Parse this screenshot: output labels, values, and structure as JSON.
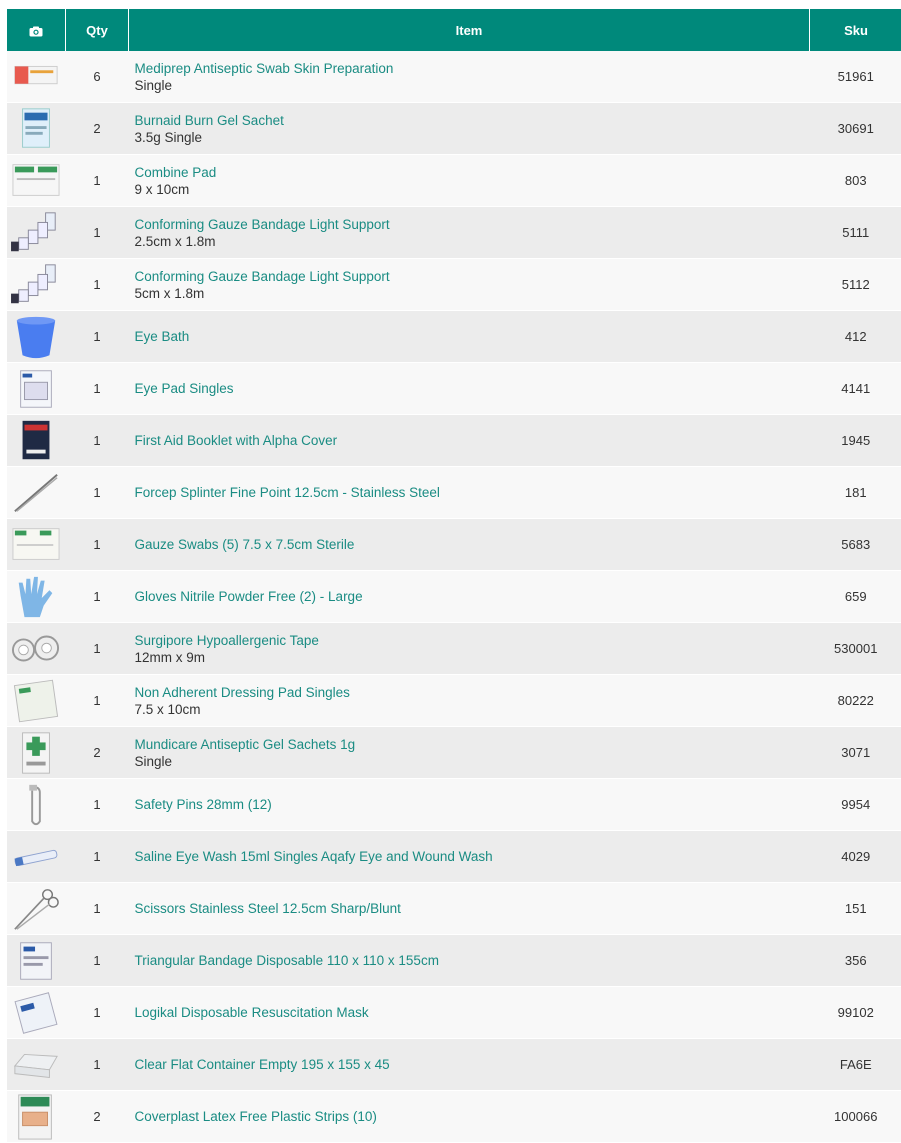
{
  "header": {
    "camera_icon": "camera-icon",
    "qty": "Qty",
    "item": "Item",
    "sku": "Sku"
  },
  "colors": {
    "header_bg": "#00897b",
    "link": "#1a8c83",
    "row_light": "#f8f8f8",
    "row_dark": "#ececec"
  },
  "rows": [
    {
      "qty": "6",
      "name": "Mediprep Antiseptic Swab Skin Preparation",
      "sub": "Single",
      "sku": "51961",
      "thumb": "swab-box-image"
    },
    {
      "qty": "2",
      "name": "Burnaid Burn Gel Sachet",
      "sub": "3.5g Single",
      "sku": "30691",
      "thumb": "gel-sachet-image"
    },
    {
      "qty": "1",
      "name": "Combine Pad",
      "sub": "9 x 10cm",
      "sku": "803",
      "thumb": "combine-pad-image"
    },
    {
      "qty": "1",
      "name": "Conforming Gauze Bandage Light Support",
      "sub": "2.5cm x 1.8m",
      "sku": "5111",
      "thumb": "bandage-rolls-image"
    },
    {
      "qty": "1",
      "name": "Conforming Gauze Bandage Light Support",
      "sub": "5cm x 1.8m",
      "sku": "5112",
      "thumb": "bandage-rolls-image"
    },
    {
      "qty": "1",
      "name": "Eye Bath",
      "sub": "",
      "sku": "412",
      "thumb": "eye-bath-image"
    },
    {
      "qty": "1",
      "name": "Eye Pad Singles",
      "sub": "",
      "sku": "4141",
      "thumb": "eye-pad-image"
    },
    {
      "qty": "1",
      "name": "First Aid Booklet with Alpha Cover",
      "sub": "",
      "sku": "1945",
      "thumb": "booklet-image"
    },
    {
      "qty": "1",
      "name": "Forcep Splinter Fine Point 12.5cm - Stainless Steel",
      "sub": "",
      "sku": "181",
      "thumb": "forcep-image"
    },
    {
      "qty": "1",
      "name": "Gauze Swabs (5) 7.5 x 7.5cm Sterile",
      "sub": "",
      "sku": "5683",
      "thumb": "gauze-swabs-image"
    },
    {
      "qty": "1",
      "name": "Gloves Nitrile Powder Free (2) - Large",
      "sub": "",
      "sku": "659",
      "thumb": "glove-image"
    },
    {
      "qty": "1",
      "name": "Surgipore Hypoallergenic Tape",
      "sub": "12mm x 9m",
      "sku": "530001",
      "thumb": "tape-image"
    },
    {
      "qty": "1",
      "name": "Non Adherent Dressing Pad Singles",
      "sub": "7.5 x 10cm",
      "sku": "80222",
      "thumb": "dressing-pad-image"
    },
    {
      "qty": "2",
      "name": "Mundicare Antiseptic Gel Sachets 1g",
      "sub": "Single",
      "sku": "3071",
      "thumb": "antiseptic-sachet-image"
    },
    {
      "qty": "1",
      "name": "Safety Pins 28mm (12)",
      "sub": "",
      "sku": "9954",
      "thumb": "safety-pin-image"
    },
    {
      "qty": "1",
      "name": "Saline Eye Wash 15ml Singles Aqafy Eye and Wound Wash",
      "sub": "",
      "sku": "4029",
      "thumb": "saline-tube-image"
    },
    {
      "qty": "1",
      "name": "Scissors Stainless Steel 12.5cm Sharp/Blunt",
      "sub": "",
      "sku": "151",
      "thumb": "scissors-image"
    },
    {
      "qty": "1",
      "name": "Triangular Bandage Disposable 110 x 110 x 155cm",
      "sub": "",
      "sku": "356",
      "thumb": "triangular-bandage-image"
    },
    {
      "qty": "1",
      "name": "Logikal Disposable Resuscitation Mask",
      "sub": "",
      "sku": "99102",
      "thumb": "resus-mask-image"
    },
    {
      "qty": "1",
      "name": "Clear Flat Container Empty 195 x 155 x 45",
      "sub": "",
      "sku": "FA6E",
      "thumb": "container-image"
    },
    {
      "qty": "2",
      "name": "Coverplast Latex Free Plastic Strips (10)",
      "sub": "",
      "sku": "100066",
      "thumb": "plastic-strips-image"
    }
  ]
}
